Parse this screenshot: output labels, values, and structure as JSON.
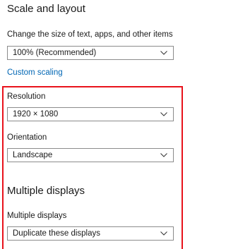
{
  "scale_layout": {
    "title": "Scale and layout",
    "size_label": "Change the size of text, apps, and other items",
    "size_value": "100% (Recommended)",
    "custom_scaling_link": "Custom scaling",
    "resolution_label": "Resolution",
    "resolution_value": "1920 × 1080",
    "orientation_label": "Orientation",
    "orientation_value": "Landscape"
  },
  "multiple_displays": {
    "title": "Multiple displays",
    "label": "Multiple displays",
    "value": "Duplicate these displays"
  },
  "colors": {
    "link": "#0066b4",
    "highlight_border": "#e8121b",
    "dropdown_border": "#8c8c8c"
  },
  "icons": {
    "dropdown": "chevron-down-icon"
  }
}
